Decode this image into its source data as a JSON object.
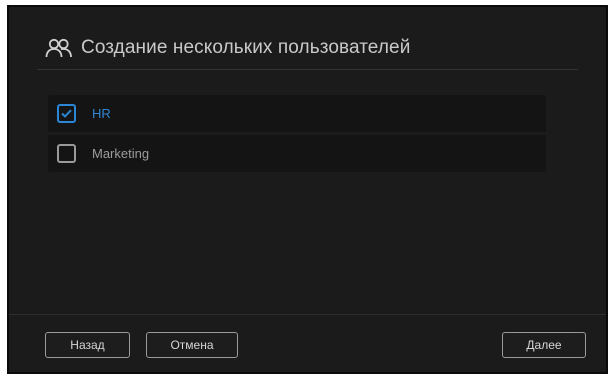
{
  "dialog": {
    "title": "Создание нескольких пользователей",
    "title_icon": "users-icon"
  },
  "groups": [
    {
      "label": "HR",
      "checked": true
    },
    {
      "label": "Marketing",
      "checked": false
    }
  ],
  "buttons": {
    "back": "Назад",
    "cancel": "Отмена",
    "next": "Далее"
  },
  "colors": {
    "background": "#1b1b1b",
    "accent": "#2f86d3",
    "text": "#c9c9c9"
  }
}
